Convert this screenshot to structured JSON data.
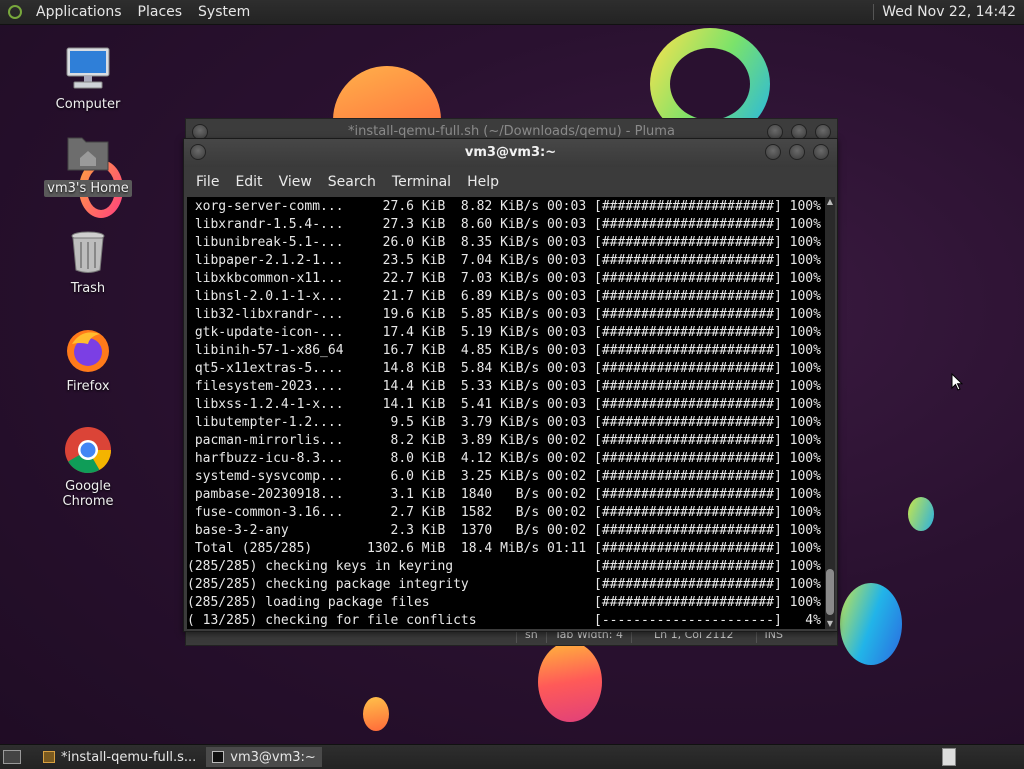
{
  "top_panel": {
    "menus": [
      "Applications",
      "Places",
      "System"
    ],
    "clock": "Wed Nov 22, 14:42"
  },
  "desktop": {
    "icons": [
      {
        "label": "Computer",
        "icon": "computer-icon"
      },
      {
        "label": "vm3's Home",
        "icon": "home-folder-icon"
      },
      {
        "label": "Trash",
        "icon": "trash-icon"
      },
      {
        "label": "Firefox",
        "icon": "firefox-icon"
      },
      {
        "label": "Google Chrome",
        "icon": "chrome-icon"
      }
    ]
  },
  "background_window": {
    "title": "*install-qemu-full.sh (~/Downloads/qemu) - Pluma",
    "status": {
      "lang": "sh",
      "tab_width": "Tab Width:  4",
      "position": "Ln 1, Col 2112",
      "mode": "INS"
    }
  },
  "terminal": {
    "title": "vm3@vm3:~",
    "menu": [
      "File",
      "Edit",
      "View",
      "Search",
      "Terminal",
      "Help"
    ],
    "lines": [
      " xorg-server-comm...     27.6 KiB  8.82 KiB/s 00:03 [######################] 100%",
      " libxrandr-1.5.4-...     27.3 KiB  8.60 KiB/s 00:03 [######################] 100%",
      " libunibreak-5.1-...     26.0 KiB  8.35 KiB/s 00:03 [######################] 100%",
      " libpaper-2.1.2-1...     23.5 KiB  7.04 KiB/s 00:03 [######################] 100%",
      " libxkbcommon-x11...     22.7 KiB  7.03 KiB/s 00:03 [######################] 100%",
      " libnsl-2.0.1-1-x...     21.7 KiB  6.89 KiB/s 00:03 [######################] 100%",
      " lib32-libxrandr-...     19.6 KiB  5.85 KiB/s 00:03 [######################] 100%",
      " gtk-update-icon-...     17.4 KiB  5.19 KiB/s 00:03 [######################] 100%",
      " libinih-57-1-x86_64     16.7 KiB  4.85 KiB/s 00:03 [######################] 100%",
      " qt5-x11extras-5....     14.8 KiB  5.84 KiB/s 00:03 [######################] 100%",
      " filesystem-2023....     14.4 KiB  5.33 KiB/s 00:03 [######################] 100%",
      " libxss-1.2.4-1-x...     14.1 KiB  5.41 KiB/s 00:03 [######################] 100%",
      " libutempter-1.2....      9.5 KiB  3.79 KiB/s 00:03 [######################] 100%",
      " pacman-mirrorlis...      8.2 KiB  3.89 KiB/s 00:02 [######################] 100%",
      " harfbuzz-icu-8.3...      8.0 KiB  4.12 KiB/s 00:02 [######################] 100%",
      " systemd-sysvcomp...      6.0 KiB  3.25 KiB/s 00:02 [######################] 100%",
      " pambase-20230918...      3.1 KiB  1840   B/s 00:02 [######################] 100%",
      " fuse-common-3.16...      2.7 KiB  1582   B/s 00:02 [######################] 100%",
      " base-3-2-any             2.3 KiB  1370   B/s 00:02 [######################] 100%",
      " Total (285/285)       1302.6 MiB  18.4 MiB/s 01:11 [######################] 100%",
      "(285/285) checking keys in keyring                  [######################] 100%",
      "(285/285) checking package integrity                [######################] 100%",
      "(285/285) loading package files                     [######################] 100%",
      "( 13/285) checking for file conflicts               [----------------------]   4%"
    ]
  },
  "taskbar": {
    "tasks": [
      {
        "label": "*install-qemu-full.s..."
      },
      {
        "label": "vm3@vm3:~"
      }
    ]
  }
}
